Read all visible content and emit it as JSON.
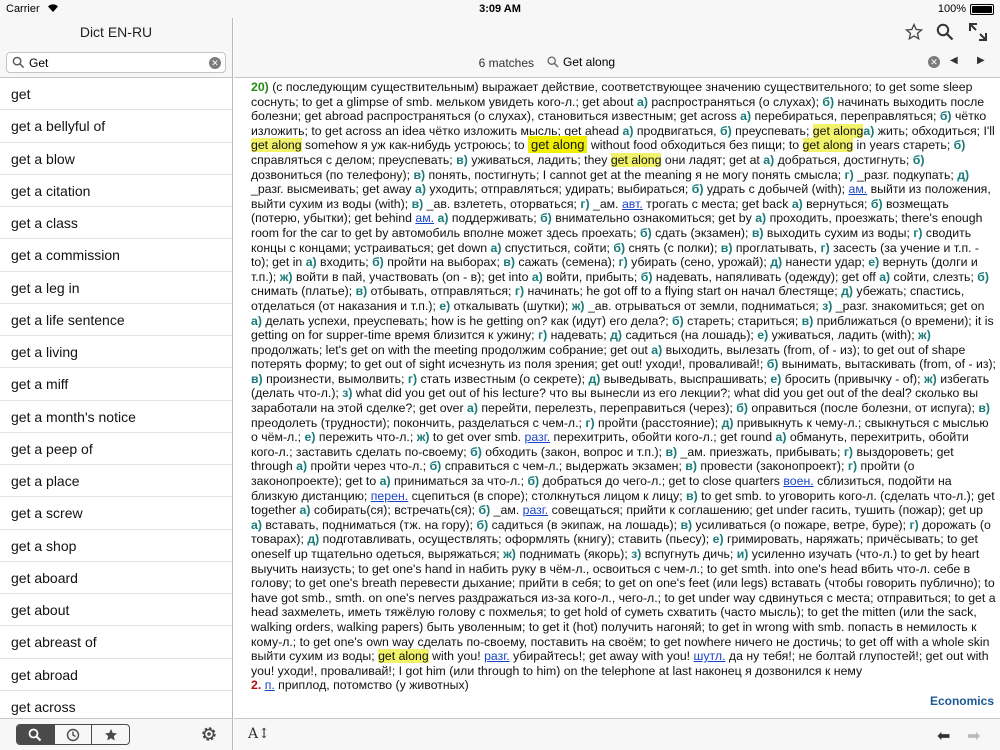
{
  "status": {
    "carrier": "Carrier",
    "time": "3:09 AM",
    "battery": "100%"
  },
  "sidebar": {
    "title": "Dict EN-RU",
    "search_value": "Get",
    "words": [
      "get",
      "get a bellyful of",
      "get a blow",
      "get a citation",
      "get a class",
      "get a commission",
      "get a leg in",
      "get a life sentence",
      "get a living",
      "get a miff",
      "get a month's notice",
      "get a peep of",
      "get a place",
      "get a screw",
      "get a shop",
      "get aboard",
      "get about",
      "get abreast of",
      "get abroad",
      "get across"
    ],
    "tabs": [
      "search-icon",
      "history-icon",
      "favorites-icon"
    ],
    "active_tab": 0
  },
  "find": {
    "matches": "6 matches",
    "query": "Get along"
  },
  "article": {
    "m20_num": "20)",
    "s1": "(с последующим существительным) выражает действие, соответствующее значению существительного; to get some sleep соснуть; to get a glimpse of smb. мельком увидеть кого-л.; get about ",
    "s1a": "а)",
    "s1a_t": " распространяться (о слухах); ",
    "s1b": "б)",
    "s1b_t": " начинать выходить после болезни; get abroad распространяться (о слухах), становиться известным; get across ",
    "s2a": "а)",
    "s2a_t": " перебираться, переправляться; ",
    "s2b": "б)",
    "s2b_t": " чётко изложить; to get across an idea чётко изложить мысль; get ahead ",
    "s3a": "а)",
    "s3a_t": " продвигаться, ",
    "s3b": "б)",
    "s3b_t": " преуспевать; ",
    "hl1": "get along",
    "s4a": "а)",
    "s4a_t": " жить; обходиться; I'll ",
    "hl2": "get along",
    "s5": " somehow я уж как-нибудь устроюсь; to ",
    "hl3": "get along",
    "s6": " without food обходиться без пищи; to ",
    "hl4": "get along",
    "s7": " in years стареть; ",
    "s7b": "б)",
    "s7b_t": " справляться с делом; преуспевать; ",
    "s7c": "в)",
    "s7c_t": " уживаться, ладить; they ",
    "hl5": "get along",
    "s8": " они ладят; get at ",
    "s8a": "а)",
    "s8a_t": " добраться, достигнуть; ",
    "s8b": "б)",
    "s8b_t": " дозвониться (по телефону); ",
    "s8c": "в)",
    "s8c_t": " понять, постигнуть; I cannot get at the meaning я не могу понять смысла; ",
    "s8d": "г)",
    "s8d_t": " _разг. подкупать; ",
    "s8e": "д)",
    "s8e_t": " _разг. высмеивать; get away ",
    "s9a": "а)",
    "s9a_t": " уходить; отправляться; удирать; выбираться; ",
    "s9b": "б)",
    "s9b_t": " удрать с добычей (with); ",
    "s9ab": "ам.",
    "s9": " выйти из положения, выйти сухим из воды (with); ",
    "s9c": "в)",
    "s9c_t": " _ав. взлететь, оторваться; ",
    "s9d": "г)",
    "s9d_t": " _ам. ",
    "s9ab2": "авт.",
    "s10": " трогать с места; get back ",
    "s10a": "а)",
    "s10a_t": " вернуться; ",
    "s10b": "б)",
    "s10b_t": " возмещать (потерю, убытки); get behind ",
    "s10ab": "ам.",
    "s11a": "а)",
    "s11a_t": " поддерживать; ",
    "s11b": "б)",
    "s11b_t": " внимательно ознакомиться; get by ",
    "s12a": "а)",
    "s12a_t": " проходить, проезжать; there's enough room for the car to get by автомобиль вполне может здесь проехать; ",
    "s12b": "б)",
    "s12b_t": " сдать (экзамен); ",
    "s12c": "в)",
    "s12c_t": " выходить сухим из воды; ",
    "s12d": "г)",
    "s12d_t": " сводить концы с концами; устраиваться; get down ",
    "s13a": "а)",
    "s13a_t": " спуститься, сойти; ",
    "s13b": "б)",
    "s13b_t": " снять (с полки); ",
    "s13c": "в)",
    "s13c_t": " проглатывать, ",
    "s13d": "г)",
    "s13d_t": " засесть (за учение и т.п. - to); get in ",
    "s14a": "а)",
    "s14a_t": " входить; ",
    "s14b": "б)",
    "s14b_t": " пройти на выборах; ",
    "s14c": "в)",
    "s14c_t": " сажать (семена); ",
    "s14d": "г)",
    "s14d_t": " убирать (сено, урожай); ",
    "s14e": "д)",
    "s14e_t": " нанести удар; ",
    "s14f": "е)",
    "s14f_t": " вернуть (долги и т.п.); ",
    "s14g": "ж)",
    "s14g_t": " войти в пай, участвовать (on - в); get into ",
    "s15a": "а)",
    "s15a_t": " войти, прибыть; ",
    "s15b": "б)",
    "s15b_t": " надевать, напяливать (одежду); get off ",
    "s15c": "а)",
    "s15c_t": " сойти, слезть; ",
    "s15d": "б)",
    "s15d_t": " снимать (платье); ",
    "s15e": "в)",
    "s15e_t": " отбывать, отправляться; ",
    "s16a": "г)",
    "s16a_t": " начинать; he got off to a flying start он начал блестяще; ",
    "s16b": "д)",
    "s16b_t": " убежать; спастись, отделаться (от наказания и т.п.); ",
    "s16c": "е)",
    "s16c_t": " откалывать (шутки); ",
    "s16d": "ж)",
    "s16d_t": " _ав. отрываться от земли, подниматься; ",
    "s16e": "з)",
    "s16e_t": " _разг. знакомиться; get on ",
    "s17a": "а)",
    "s17a_t": " делать успехи, преуспевать; how is he getting on? как (идут) его дела?; ",
    "s17b": "б)",
    "s17b_t": " стареть; стариться; ",
    "s17c": "в)",
    "s17c_t": " приближаться (о времени); it is getting on for supper-time время близится к ужину; ",
    "s18a": "г)",
    "s18a_t": " надевать; ",
    "s18b": "д)",
    "s18b_t": " садиться (на лошадь); ",
    "s18c": "е)",
    "s18c_t": " уживаться, ладить (with); ",
    "s18d": "ж)",
    "s18d_t": " продолжать; let's get on with the meeting продолжим собрание; get out ",
    "s19a": "а)",
    "s19a_t": " выходить, вылезать (from, of - из); to get out of shape потерять форму; to get out of sight исчезнуть из поля зрения; get out! уходи!, проваливай!; ",
    "s19b": "б)",
    "s19b_t": " вынимать, вытаскивать (from, of - из); ",
    "s19c": "в)",
    "s19c_t": " произнести, вымолвить; ",
    "s19d": "г)",
    "s19d_t": " стать известным (о секрете); ",
    "s20a": "д)",
    "s20a_t": " выведывать, выспрашивать; ",
    "s20b": "е)",
    "s20b_t": " бросить (привычку - of); ",
    "s20c": "ж)",
    "s20c_t": " избегать (делать что-л.); ",
    "s20d": "з)",
    "s20d_t": " what did you get out of his lecture? что вы вынесли из его лекции?; what did you get out of the deal? сколько вы заработали на этой сделке?; get over ",
    "s21a": "а)",
    "s21a_t": " перейти, перелезть, переправиться (через); ",
    "s21b": "б)",
    "s21b_t": " оправиться (после болезни, от испуга); ",
    "s21c": "в)",
    "s21c_t": " преодолеть (трудности); покончить, разделаться с чем-л.; ",
    "s22a": "г)",
    "s22a_t": " пройти (расстояние); ",
    "s22b": "д)",
    "s22b_t": " привыкнуть к чему-л.; свыкнуться с мыслью о чём-л.; ",
    "s22c": "е)",
    "s22c_t": " пережить что-л.; ",
    "s22d": "ж)",
    "s22d_t": " to get over smb. ",
    "s22ab": "разг.",
    "s23": " перехитрить, обойти кого-л.; get round ",
    "s23a": "а)",
    "s23a_t": " обмануть, перехитрить, обойти кого-л.; заставить сделать по-своему; ",
    "s23b": "б)",
    "s23b_t": " обходить (закон, вопрос и т.п.); ",
    "s23c": "в)",
    "s23c_t": " _ам. приезжать, прибывать; ",
    "s23d": "г)",
    "s23d_t": " выздороветь; get through ",
    "s24a": "а)",
    "s24a_t": " пройти через что-л.; ",
    "s24b": "б)",
    "s24b_t": " справиться с чем-л.; выдержать экзамен; ",
    "s24c": "в)",
    "s24c_t": " провести (законопроект); ",
    "s24d": "г)",
    "s24d_t": " пройти (о законопроекте); get to ",
    "s24e": "а)",
    "s24e_t": " приниматься за что-л.; ",
    "s24f": "б)",
    "s24f_t": " добраться до чего-л.; get to close quarters ",
    "s24ab": "воен.",
    "s25": " сблизиться, подойти на близкую дистанцию; ",
    "s25ab": "перен.",
    "s26": " сцепиться (в споре); столкнуться лицом к лицу; ",
    "s26a": "в)",
    "s26a_t": " to get smb. to уговорить кого-л. (сделать что-л.); get together ",
    "s26b": "а)",
    "s26b_t": " собирать(ся); встречать(ся); ",
    "s26c": "б)",
    "s26c_t": " _ам. ",
    "s26ab": "разг.",
    "s27": " совещаться; прийти к соглашению; get under гасить, тушить (пожар); get up ",
    "s27a": "а)",
    "s27a_t": " вставать, подниматься (тж. на гору); ",
    "s27b": "б)",
    "s27b_t": " садиться (в экипаж, на лошадь); ",
    "s27c": "в)",
    "s27c_t": " усиливаться (о пожаре, ветре, буре); ",
    "s28a": "г)",
    "s28a_t": " дорожать (о товарах); ",
    "s28b": "д)",
    "s28b_t": " подготавливать, осуществлять; оформлять (книгу); ставить (пьесу); ",
    "s28c": "е)",
    "s28c_t": " гримировать, наряжать; причёсывать; to get oneself up тщательно одеться, выряжаться; ",
    "s28d": "ж)",
    "s28d_t": " поднимать (якорь); ",
    "s28e": "з)",
    "s28e_t": " вспугнуть дичь; ",
    "s28f": "и)",
    "s28f_t": " усиленно изучать (что-л.) to get by heart выучить наизусть; to get one's hand in набить руку в чём-л., освоиться с чем-л.; to get smth. into one's head вбить что-л. себе в голову; to get one's breath перевести дыхание; прийти в себя; to get on one's feet (или legs) вставать (чтобы говорить публично); to have got smb., smth. on one's nerves раздражаться из-за кого-л., чего-л.; to get under way сдвинуться с места; отправиться; to get a head захмелеть, иметь тяжёлую голову с похмелья; to get hold of суметь схватить (часто мысль); to get the mitten (или the sack, walking orders, walking papers) быть уволенным; to get it (hot) получить нагоняй; to get in wrong with smb. попасть в немилость к кому-л.; to get one's own way сделать по-своему, поставить на своём; to get nowhere ничего не достичь; to get off with a whole skin выйти сухим из воды; ",
    "hl6": "get along",
    "s29": " with you! ",
    "s29ab": "разг.",
    "s30": " убирайтесь!; get away with you! ",
    "s30ab": "шутл.",
    "s31": " да ну тебя!; не болтай глупостей!; get out with you! уходи!, проваливай!; I got him (или through to him) on the telephone at last наконец я дозвонился к нему",
    "m2_num": "2.",
    "m2_ab": "п.",
    "m2_t": " приплод, потомство (у животных)"
  },
  "subject": "Economics",
  "toolbar": {
    "font_size": "A↕"
  }
}
